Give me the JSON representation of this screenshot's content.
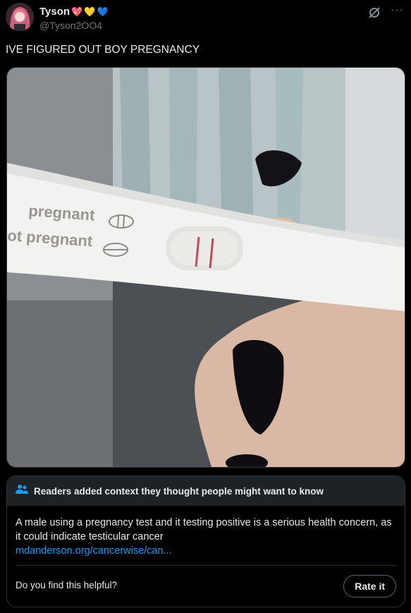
{
  "author": {
    "name": "Tyson",
    "emojis": [
      "💖",
      "💛",
      "💙"
    ],
    "handle": "@Tyson2OO4"
  },
  "more_label": "···",
  "tweet": {
    "text": "IVE FIGURED OUT BOY PREGNANCY"
  },
  "photo": {
    "test_labels": [
      "pregnant",
      "ot pregnant"
    ]
  },
  "note": {
    "header": "Readers added context they thought people might want to know",
    "body": "A male using a pregnancy test and it testing positive is a serious health concern, as it could indicate testicular cancer",
    "link": "mdanderson.org/cancerwise/can...",
    "question": "Do you find this helpful?",
    "rate_label": "Rate it"
  },
  "colors": {
    "background": "#000000",
    "link": "#1d9bf0",
    "note_header_bg": "#1e2226",
    "border": "#2f3336"
  },
  "icons": [
    "grok-icon",
    "more-icon",
    "people-icon"
  ]
}
